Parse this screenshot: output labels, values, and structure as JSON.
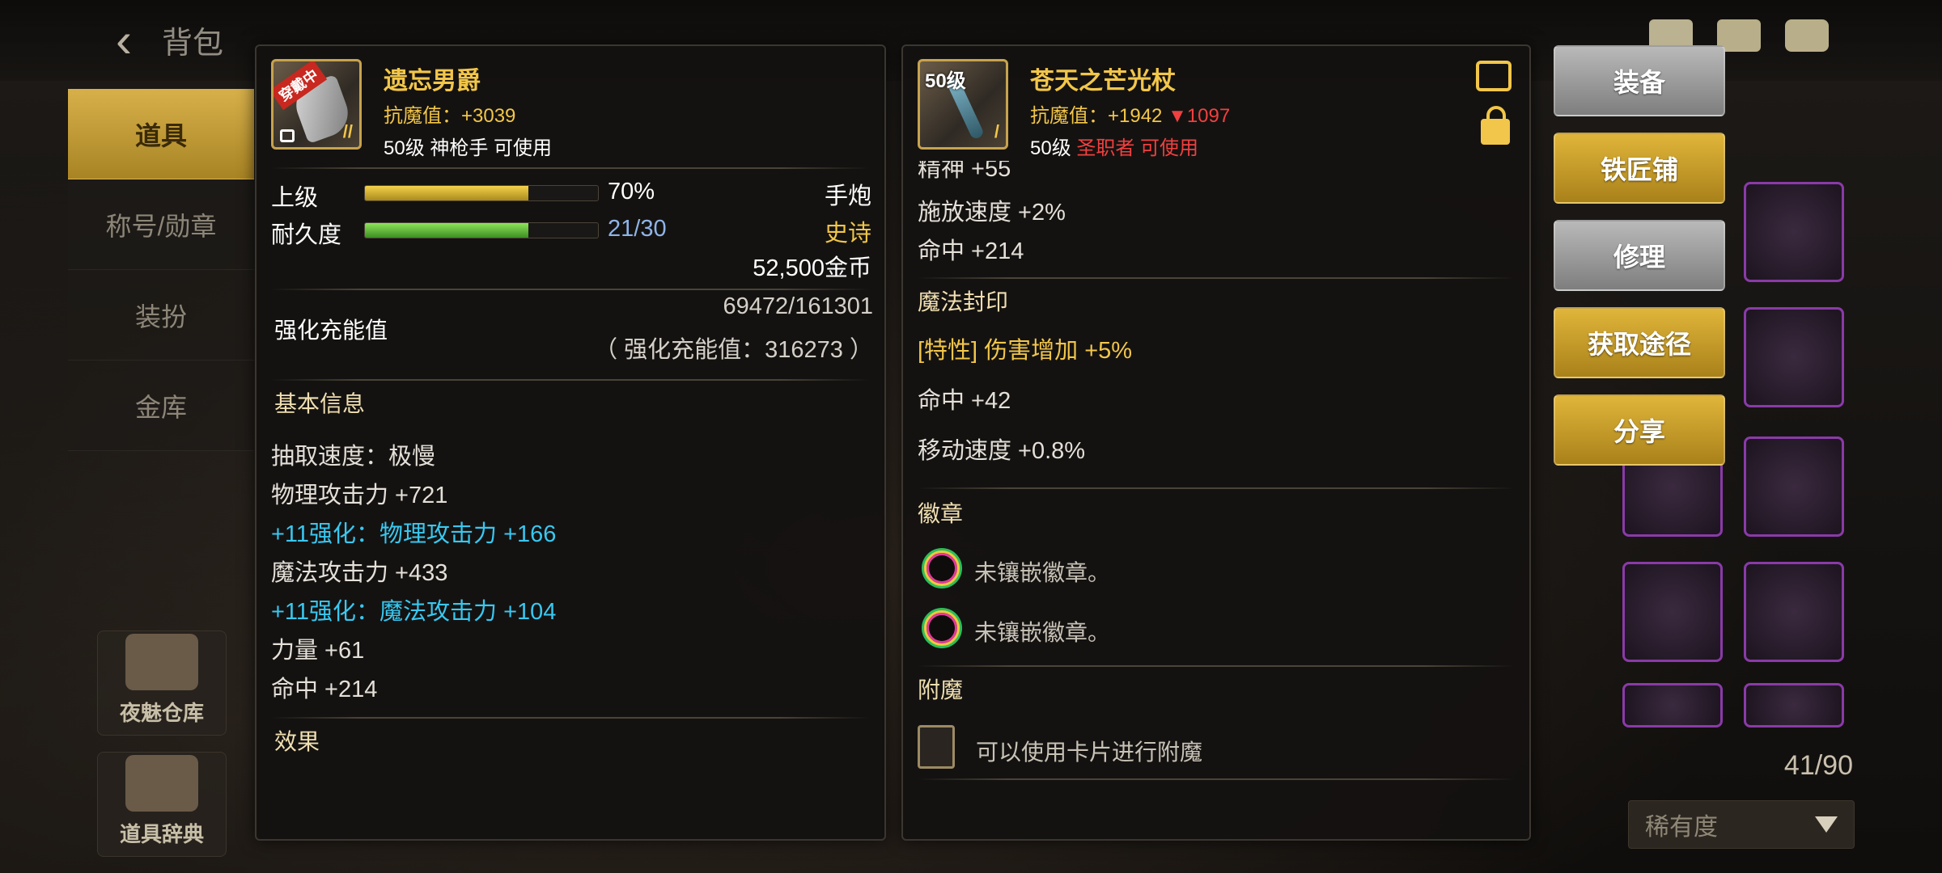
{
  "top": {
    "title": "背包"
  },
  "sidebar": {
    "tabs": [
      {
        "label": "道具",
        "active": true
      },
      {
        "label": "称号/勋章",
        "active": false
      },
      {
        "label": "装扮",
        "active": false
      },
      {
        "label": "金库",
        "active": false
      }
    ],
    "bottom": [
      {
        "label": "夜魅仓库"
      },
      {
        "label": "道具辞典"
      }
    ]
  },
  "left_item": {
    "name": "遗忘男爵",
    "resist": "抗魔值：+3039",
    "requirement": "50级 神枪手 可使用",
    "badge": "穿戴中",
    "upgrade": {
      "label": "上级",
      "percent": 70,
      "text": "70%",
      "right": "手炮"
    },
    "durability": {
      "label": "耐久度",
      "current": 21,
      "max": 30,
      "text": "21/30",
      "right": "史诗"
    },
    "price": "52,500金币",
    "charge": {
      "label": "强化充能值",
      "value": "69472/161301",
      "total": "（ 强化充能值：316273 ）"
    },
    "basic_title": "基本信息",
    "stats": [
      {
        "text": "抽取速度：极慢",
        "color": "white"
      },
      {
        "text": "物理攻击力 +721",
        "color": "white"
      },
      {
        "text": "+11强化：物理攻击力 +166",
        "color": "cyan"
      },
      {
        "text": "魔法攻击力 +433",
        "color": "white"
      },
      {
        "text": "+11强化：魔法攻击力 +104",
        "color": "cyan"
      },
      {
        "text": "力量 +61",
        "color": "white"
      },
      {
        "text": "命中 +214",
        "color": "white"
      }
    ],
    "effect_title": "效果"
  },
  "right_item": {
    "level_badge": "50级",
    "name": "苍天之芒光杖",
    "resist": "抗魔值：+1942 ",
    "resist_down": "▼1097",
    "req_level": "50级 ",
    "req_class": "圣职者 可使用",
    "partial_stat": "精神 +55",
    "stats": [
      "施放速度 +2%",
      "命中 +214"
    ],
    "seal_title": "魔法封印",
    "seal_stats": [
      {
        "text": "[特性] 伤害增加 +5%",
        "color": "yellow"
      },
      {
        "text": "命中 +42",
        "color": "white"
      },
      {
        "text": "移动速度 +0.8%",
        "color": "white"
      }
    ],
    "emblem_title": "徽章",
    "emblems": [
      "未镶嵌徽章。",
      "未镶嵌徽章。"
    ],
    "enchant_title": "附魔",
    "enchant_text": "可以使用卡片进行附魔"
  },
  "actions": [
    {
      "label": "装备",
      "style": "gray"
    },
    {
      "label": "铁匠铺",
      "style": "gold"
    },
    {
      "label": "修理",
      "style": "gray"
    },
    {
      "label": "获取途径",
      "style": "gold"
    },
    {
      "label": "分享",
      "style": "gold"
    }
  ],
  "inventory": {
    "count": "41/90",
    "sort_label": "稀有度"
  },
  "colors": {
    "gold": "#f2c64a",
    "cyan": "#38c8f0",
    "red": "#f04040",
    "blue": "#8fb4e8"
  }
}
